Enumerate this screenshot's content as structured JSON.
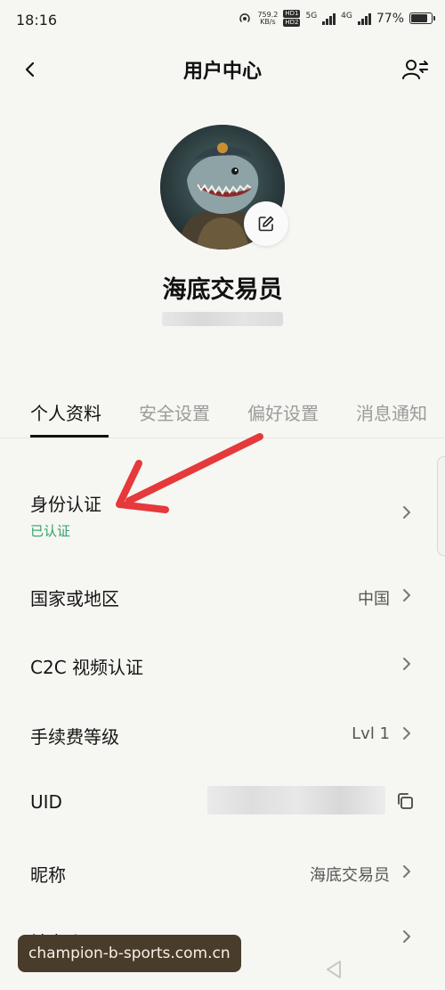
{
  "status_bar": {
    "time": "18:16",
    "speed_value": "759.2",
    "speed_unit": "KB/s",
    "hd1": "HD1",
    "hd2": "HD2",
    "net1": "5G",
    "net2": "4G",
    "battery": "77%"
  },
  "header": {
    "title": "用户中心"
  },
  "profile": {
    "username": "海底交易员"
  },
  "tabs": [
    {
      "label": "个人资料",
      "active": true
    },
    {
      "label": "安全设置",
      "active": false
    },
    {
      "label": "偏好设置",
      "active": false
    },
    {
      "label": "消息通知",
      "active": false
    }
  ],
  "rows": {
    "identity": {
      "label": "身份认证",
      "status": "已认证"
    },
    "country": {
      "label": "国家或地区",
      "value": "中国"
    },
    "c2c": {
      "label": "C2C 视频认证"
    },
    "fee": {
      "label": "手续费等级",
      "value": "Lvl 1"
    },
    "uid": {
      "label": "UID"
    },
    "nickname": {
      "label": "昵称",
      "value": "海底交易员"
    },
    "social": {
      "label": "社交账号"
    }
  },
  "watermark": "champion-b-sports.com.cn",
  "colors": {
    "background": "#f6f6f2",
    "verified_green": "#2ea36b",
    "annotation_red": "#e5393b"
  }
}
